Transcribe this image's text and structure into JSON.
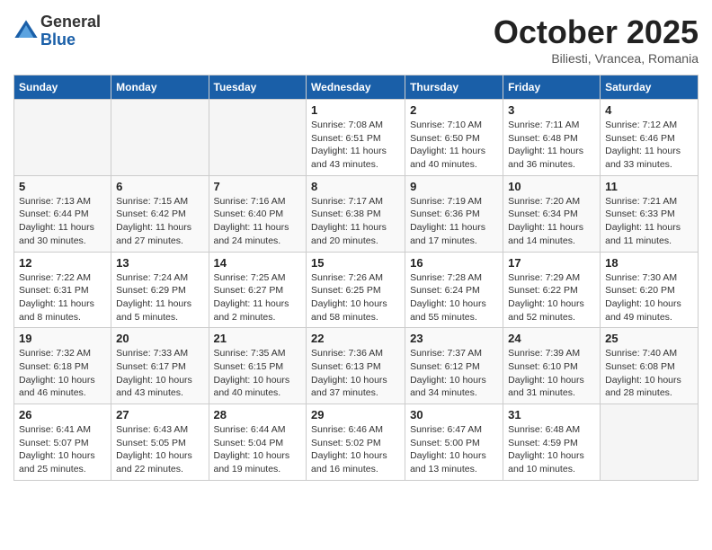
{
  "header": {
    "logo_general": "General",
    "logo_blue": "Blue",
    "month_title": "October 2025",
    "subtitle": "Biliesti, Vrancea, Romania"
  },
  "weekdays": [
    "Sunday",
    "Monday",
    "Tuesday",
    "Wednesday",
    "Thursday",
    "Friday",
    "Saturday"
  ],
  "weeks": [
    [
      {
        "day": "",
        "info": ""
      },
      {
        "day": "",
        "info": ""
      },
      {
        "day": "",
        "info": ""
      },
      {
        "day": "1",
        "info": "Sunrise: 7:08 AM\nSunset: 6:51 PM\nDaylight: 11 hours\nand 43 minutes."
      },
      {
        "day": "2",
        "info": "Sunrise: 7:10 AM\nSunset: 6:50 PM\nDaylight: 11 hours\nand 40 minutes."
      },
      {
        "day": "3",
        "info": "Sunrise: 7:11 AM\nSunset: 6:48 PM\nDaylight: 11 hours\nand 36 minutes."
      },
      {
        "day": "4",
        "info": "Sunrise: 7:12 AM\nSunset: 6:46 PM\nDaylight: 11 hours\nand 33 minutes."
      }
    ],
    [
      {
        "day": "5",
        "info": "Sunrise: 7:13 AM\nSunset: 6:44 PM\nDaylight: 11 hours\nand 30 minutes."
      },
      {
        "day": "6",
        "info": "Sunrise: 7:15 AM\nSunset: 6:42 PM\nDaylight: 11 hours\nand 27 minutes."
      },
      {
        "day": "7",
        "info": "Sunrise: 7:16 AM\nSunset: 6:40 PM\nDaylight: 11 hours\nand 24 minutes."
      },
      {
        "day": "8",
        "info": "Sunrise: 7:17 AM\nSunset: 6:38 PM\nDaylight: 11 hours\nand 20 minutes."
      },
      {
        "day": "9",
        "info": "Sunrise: 7:19 AM\nSunset: 6:36 PM\nDaylight: 11 hours\nand 17 minutes."
      },
      {
        "day": "10",
        "info": "Sunrise: 7:20 AM\nSunset: 6:34 PM\nDaylight: 11 hours\nand 14 minutes."
      },
      {
        "day": "11",
        "info": "Sunrise: 7:21 AM\nSunset: 6:33 PM\nDaylight: 11 hours\nand 11 minutes."
      }
    ],
    [
      {
        "day": "12",
        "info": "Sunrise: 7:22 AM\nSunset: 6:31 PM\nDaylight: 11 hours\nand 8 minutes."
      },
      {
        "day": "13",
        "info": "Sunrise: 7:24 AM\nSunset: 6:29 PM\nDaylight: 11 hours\nand 5 minutes."
      },
      {
        "day": "14",
        "info": "Sunrise: 7:25 AM\nSunset: 6:27 PM\nDaylight: 11 hours\nand 2 minutes."
      },
      {
        "day": "15",
        "info": "Sunrise: 7:26 AM\nSunset: 6:25 PM\nDaylight: 10 hours\nand 58 minutes."
      },
      {
        "day": "16",
        "info": "Sunrise: 7:28 AM\nSunset: 6:24 PM\nDaylight: 10 hours\nand 55 minutes."
      },
      {
        "day": "17",
        "info": "Sunrise: 7:29 AM\nSunset: 6:22 PM\nDaylight: 10 hours\nand 52 minutes."
      },
      {
        "day": "18",
        "info": "Sunrise: 7:30 AM\nSunset: 6:20 PM\nDaylight: 10 hours\nand 49 minutes."
      }
    ],
    [
      {
        "day": "19",
        "info": "Sunrise: 7:32 AM\nSunset: 6:18 PM\nDaylight: 10 hours\nand 46 minutes."
      },
      {
        "day": "20",
        "info": "Sunrise: 7:33 AM\nSunset: 6:17 PM\nDaylight: 10 hours\nand 43 minutes."
      },
      {
        "day": "21",
        "info": "Sunrise: 7:35 AM\nSunset: 6:15 PM\nDaylight: 10 hours\nand 40 minutes."
      },
      {
        "day": "22",
        "info": "Sunrise: 7:36 AM\nSunset: 6:13 PM\nDaylight: 10 hours\nand 37 minutes."
      },
      {
        "day": "23",
        "info": "Sunrise: 7:37 AM\nSunset: 6:12 PM\nDaylight: 10 hours\nand 34 minutes."
      },
      {
        "day": "24",
        "info": "Sunrise: 7:39 AM\nSunset: 6:10 PM\nDaylight: 10 hours\nand 31 minutes."
      },
      {
        "day": "25",
        "info": "Sunrise: 7:40 AM\nSunset: 6:08 PM\nDaylight: 10 hours\nand 28 minutes."
      }
    ],
    [
      {
        "day": "26",
        "info": "Sunrise: 6:41 AM\nSunset: 5:07 PM\nDaylight: 10 hours\nand 25 minutes."
      },
      {
        "day": "27",
        "info": "Sunrise: 6:43 AM\nSunset: 5:05 PM\nDaylight: 10 hours\nand 22 minutes."
      },
      {
        "day": "28",
        "info": "Sunrise: 6:44 AM\nSunset: 5:04 PM\nDaylight: 10 hours\nand 19 minutes."
      },
      {
        "day": "29",
        "info": "Sunrise: 6:46 AM\nSunset: 5:02 PM\nDaylight: 10 hours\nand 16 minutes."
      },
      {
        "day": "30",
        "info": "Sunrise: 6:47 AM\nSunset: 5:00 PM\nDaylight: 10 hours\nand 13 minutes."
      },
      {
        "day": "31",
        "info": "Sunrise: 6:48 AM\nSunset: 4:59 PM\nDaylight: 10 hours\nand 10 minutes."
      },
      {
        "day": "",
        "info": ""
      }
    ]
  ]
}
